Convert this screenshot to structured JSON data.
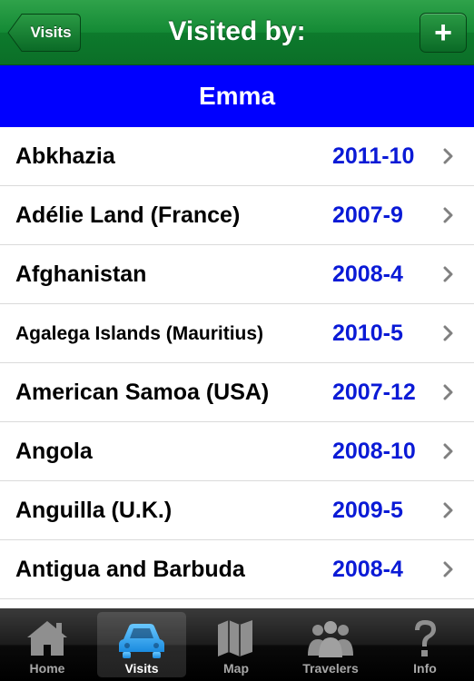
{
  "navbar": {
    "back_label": "Visits",
    "title": "Visited by:",
    "add_label": "+",
    "colors": {
      "bar": "#148a35"
    }
  },
  "traveler": {
    "name": "Emma",
    "color": "#0000ff"
  },
  "visits": [
    {
      "country": "Abkhazia",
      "date": "2011-10"
    },
    {
      "country": "Adélie Land (France)",
      "date": "2007-9"
    },
    {
      "country": "Afghanistan",
      "date": "2008-4"
    },
    {
      "country": "Agalega Islands (Mauritius)",
      "date": "2010-5"
    },
    {
      "country": "American Samoa (USA)",
      "date": "2007-12"
    },
    {
      "country": "Angola",
      "date": "2008-10"
    },
    {
      "country": "Anguilla (U.K.)",
      "date": "2009-5"
    },
    {
      "country": "Antigua and Barbuda",
      "date": "2008-4"
    }
  ],
  "tabs": [
    {
      "label": "Home",
      "icon": "home-icon"
    },
    {
      "label": "Visits",
      "icon": "car-icon",
      "active": true
    },
    {
      "label": "Map",
      "icon": "map-icon"
    },
    {
      "label": "Travelers",
      "icon": "travelers-icon"
    },
    {
      "label": "Info",
      "icon": "question-icon"
    }
  ]
}
